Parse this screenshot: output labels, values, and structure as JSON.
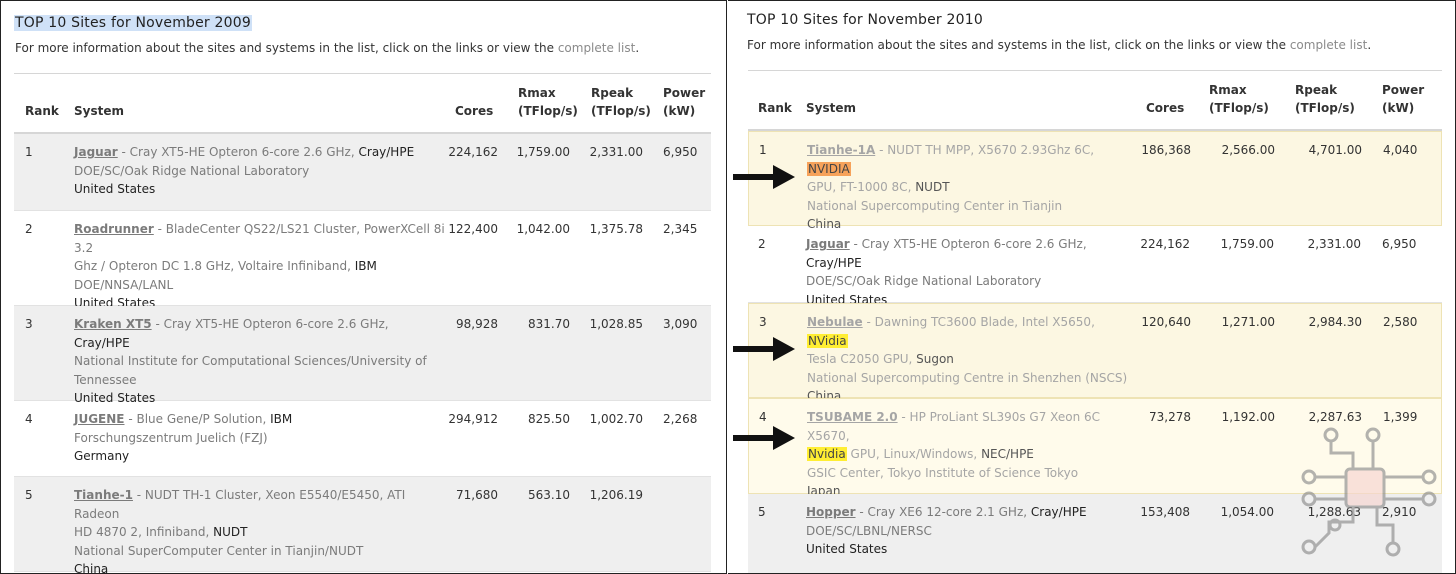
{
  "left": {
    "heading": "TOP 10 Sites for November 2009",
    "intro_prefix": "For more information about the sites and systems in the list, click on the links or view the ",
    "intro_link": "complete list",
    "intro_suffix": ".",
    "headers": {
      "rank": "Rank",
      "system": "System",
      "cores": "Cores",
      "rmax_1": "Rmax",
      "rmax_2": "(TFlop/s)",
      "rpeak_1": "Rpeak",
      "rpeak_2": "(TFlop/s)",
      "power_1": "Power",
      "power_2": "(kW)"
    },
    "rows": [
      {
        "rank": "1",
        "name": "Jaguar",
        "desc_a": " - Cray XT5-HE Opteron 6-core 2.6 GHz, ",
        "vendor": "Cray/HPE",
        "line2": "",
        "site": "DOE/SC/Oak Ridge National Laboratory",
        "site2": "",
        "country": "United States",
        "cores": "224,162",
        "rmax": "1,759.00",
        "rpeak": "2,331.00",
        "power": "6,950"
      },
      {
        "rank": "2",
        "name": "Roadrunner",
        "desc_a": " - BladeCenter QS22/LS21 Cluster, PowerXCell 8i 3.2",
        "vendor": "IBM",
        "line2": "Ghz / Opteron DC 1.8 GHz, Voltaire Infiniband, ",
        "site": "DOE/NNSA/LANL",
        "site2": "",
        "country": "United States",
        "cores": "122,400",
        "rmax": "1,042.00",
        "rpeak": "1,375.78",
        "power": "2,345"
      },
      {
        "rank": "3",
        "name": "Kraken XT5",
        "desc_a": " - Cray XT5-HE Opteron 6-core 2.6 GHz, ",
        "vendor": "Cray/HPE",
        "line2": "",
        "site": "National Institute for Computational Sciences/University of",
        "site2": "Tennessee",
        "country": "United States",
        "cores": "98,928",
        "rmax": "831.70",
        "rpeak": "1,028.85",
        "power": "3,090"
      },
      {
        "rank": "4",
        "name": "JUGENE",
        "desc_a": " - Blue Gene/P Solution, ",
        "vendor": "IBM",
        "line2": "",
        "site": "Forschungszentrum Juelich (FZJ)",
        "site2": "",
        "country": "Germany",
        "cores": "294,912",
        "rmax": "825.50",
        "rpeak": "1,002.70",
        "power": "2,268"
      },
      {
        "rank": "5",
        "name": "Tianhe-1",
        "desc_a": " - NUDT TH-1 Cluster, Xeon E5540/E5450, ATI Radeon",
        "vendor": "NUDT",
        "line2": "HD 4870 2, Infiniband, ",
        "site": "National SuperComputer Center in Tianjin/NUDT",
        "site2": "",
        "country": "China",
        "cores": "71,680",
        "rmax": "563.10",
        "rpeak": "1,206.19",
        "power": ""
      }
    ]
  },
  "right": {
    "heading": "TOP 10 Sites for November 2010",
    "intro_prefix": "For more information about the sites and systems in the list, click on the links or view the ",
    "intro_link": "complete list",
    "intro_suffix": ".",
    "headers": {
      "rank": "Rank",
      "system": "System",
      "cores": "Cores",
      "rmax_1": "Rmax",
      "rmax_2": "(TFlop/s)",
      "rpeak_1": "Rpeak",
      "rpeak_2": "(TFlop/s)",
      "power_1": "Power",
      "power_2": "(kW)"
    },
    "rows": [
      {
        "rank": "1",
        "name": "Tianhe-1A",
        "desc_a": " - NUDT TH MPP, X5670 2.93Ghz 6C, ",
        "gpu": "NVIDIA",
        "desc_b": "GPU, FT-1000 8C, ",
        "vendor": "NUDT",
        "site": "National Supercomputing Center in Tianjin",
        "country": "China",
        "cores": "186,368",
        "rmax": "2,566.00",
        "rpeak": "4,701.00",
        "power": "4,040"
      },
      {
        "rank": "2",
        "name": "Jaguar",
        "desc_a": " - Cray XT5-HE Opteron 6-core 2.6 GHz, ",
        "vendor": "Cray/HPE",
        "site": "DOE/SC/Oak Ridge National Laboratory",
        "country": "United States",
        "cores": "224,162",
        "rmax": "1,759.00",
        "rpeak": "2,331.00",
        "power": "6,950"
      },
      {
        "rank": "3",
        "name": "Nebulae",
        "desc_a": " - Dawning TC3600 Blade, Intel X5650, ",
        "gpu": "NVidia",
        "desc_b": "Tesla C2050 GPU, ",
        "vendor": "Sugon",
        "site": "National Supercomputing Centre in Shenzhen (NSCS)",
        "country": "China",
        "cores": "120,640",
        "rmax": "1,271.00",
        "rpeak": "2,984.30",
        "power": "2,580"
      },
      {
        "rank": "4",
        "name": "TSUBAME 2.0",
        "desc_a": " - HP ProLiant SL390s G7 Xeon 6C X5670,",
        "gpu": "Nvidia",
        "desc_b": " GPU, Linux/Windows, ",
        "vendor": "NEC/HPE",
        "site": "GSIC Center, Tokyo Institute of Science Tokyo",
        "country": "Japan",
        "cores": "73,278",
        "rmax": "1,192.00",
        "rpeak": "2,287.63",
        "power": "1,399"
      },
      {
        "rank": "5",
        "name": "Hopper",
        "desc_a": " - Cray XE6 12-core 2.1 GHz, ",
        "vendor": "Cray/HPE",
        "site": "DOE/SC/LBNL/NERSC",
        "country": "United States",
        "cores": "153,408",
        "rmax": "1,054.00",
        "rpeak": "1,288.63",
        "power": "2,910"
      }
    ]
  },
  "colors": {
    "highlight_orange": "#f6a25a",
    "highlight_yellow": "#ffee33",
    "selection_blue": "#cfe1f7",
    "row_gray": "#efefef"
  },
  "icons": {
    "arrow": "arrow-right-icon",
    "watermark": "circuit-chip-icon"
  }
}
